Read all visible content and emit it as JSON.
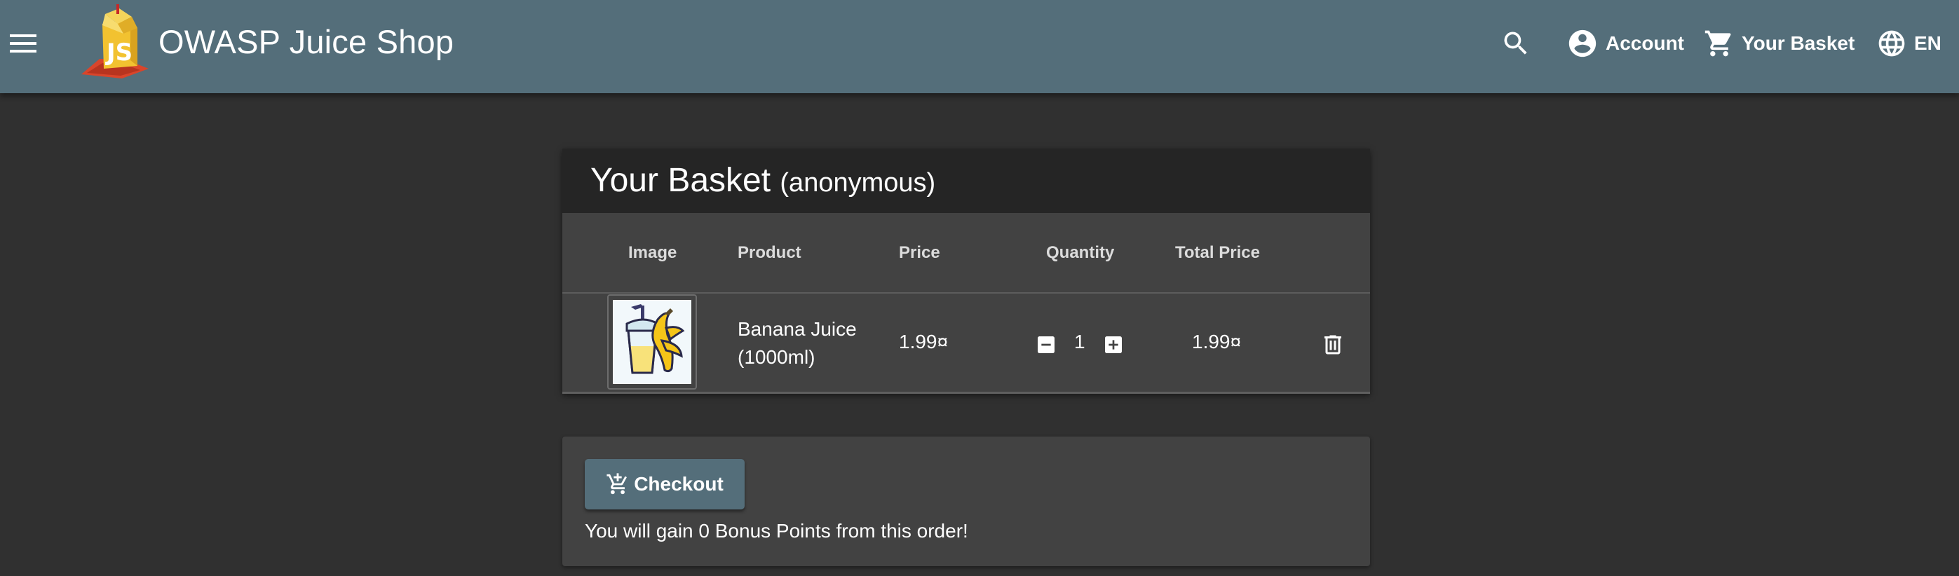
{
  "toolbar": {
    "menu_icon": "menu-icon",
    "logo_icon": "juice-shop-logo",
    "app_title": "OWASP Juice Shop",
    "search_icon": "search-icon",
    "account_label": "Account",
    "account_icon": "account-circle-icon",
    "basket_label": "Your Basket",
    "basket_icon": "shopping-cart-icon",
    "language_label": "EN",
    "language_icon": "globe-icon"
  },
  "basket": {
    "title": "Your Basket",
    "user": "(anonymous)",
    "columns": {
      "image": "Image",
      "product": "Product",
      "price": "Price",
      "quantity": "Quantity",
      "total_price": "Total Price"
    },
    "items": [
      {
        "image_icon": "banana-juice-icon",
        "product": "Banana Juice (1000ml)",
        "price": "1.99¤",
        "quantity": "1",
        "total_price": "1.99¤",
        "decrease_icon": "minus-box-icon",
        "increase_icon": "plus-box-icon",
        "delete_icon": "trash-icon"
      }
    ]
  },
  "checkout": {
    "button_label": "Checkout",
    "button_icon": "cart-plus-icon",
    "bonus_text": "You will gain 0 Bonus Points from this order!"
  },
  "colors": {
    "toolbar": "#546e7a",
    "page_background": "#303030",
    "card_background": "#424242",
    "card_header": "#252525",
    "button_primary": "#546e7a"
  }
}
